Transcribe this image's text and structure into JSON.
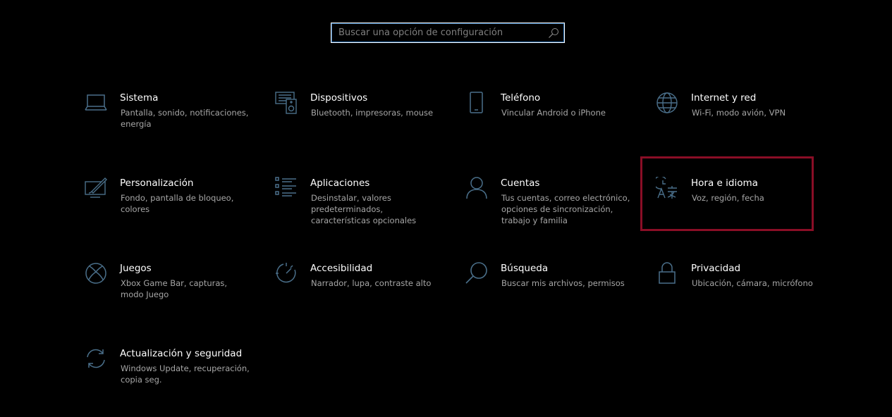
{
  "search": {
    "placeholder": "Buscar una opción de configuración",
    "value": ""
  },
  "tiles": [
    {
      "title": "Sistema",
      "desc": "Pantalla, sonido, notificaciones, energía",
      "icon": "laptop-icon"
    },
    {
      "title": "Dispositivos",
      "desc": "Bluetooth, impresoras, mouse",
      "icon": "devices-icon"
    },
    {
      "title": "Teléfono",
      "desc": "Vincular Android o iPhone",
      "icon": "phone-icon"
    },
    {
      "title": "Internet y red",
      "desc": "Wi-Fi, modo avión, VPN",
      "icon": "globe-icon"
    },
    {
      "title": "Personalización",
      "desc": "Fondo, pantalla de bloqueo, colores",
      "icon": "personalization-icon"
    },
    {
      "title": "Aplicaciones",
      "desc": "Desinstalar, valores predeterminados, características opcionales",
      "icon": "apps-list-icon"
    },
    {
      "title": "Cuentas",
      "desc": "Tus cuentas, correo electrónico, opciones de sincronización, trabajo y familia",
      "icon": "person-icon"
    },
    {
      "title": "Hora e idioma",
      "desc": "Voz, región, fecha",
      "icon": "time-language-icon"
    },
    {
      "title": "Juegos",
      "desc": "Xbox Game Bar, capturas, modo Juego",
      "icon": "xbox-icon"
    },
    {
      "title": "Accesibilidad",
      "desc": "Narrador, lupa, contraste alto",
      "icon": "accessibility-icon"
    },
    {
      "title": "Búsqueda",
      "desc": "Buscar mis archivos, permisos",
      "icon": "magnifier-icon"
    },
    {
      "title": "Privacidad",
      "desc": "Ubicación, cámara, micrófono",
      "icon": "lock-icon"
    },
    {
      "title": "Actualización y seguridad",
      "desc": "Windows Update, recuperación, copia seg.",
      "icon": "sync-icon"
    }
  ],
  "colors": {
    "background": "#000000",
    "icon": "#4a6f8a",
    "highlight": "#8a0e26",
    "title": "#ffffff",
    "description": "#a6a6a6"
  },
  "highlighted_tile": "Hora e idioma"
}
